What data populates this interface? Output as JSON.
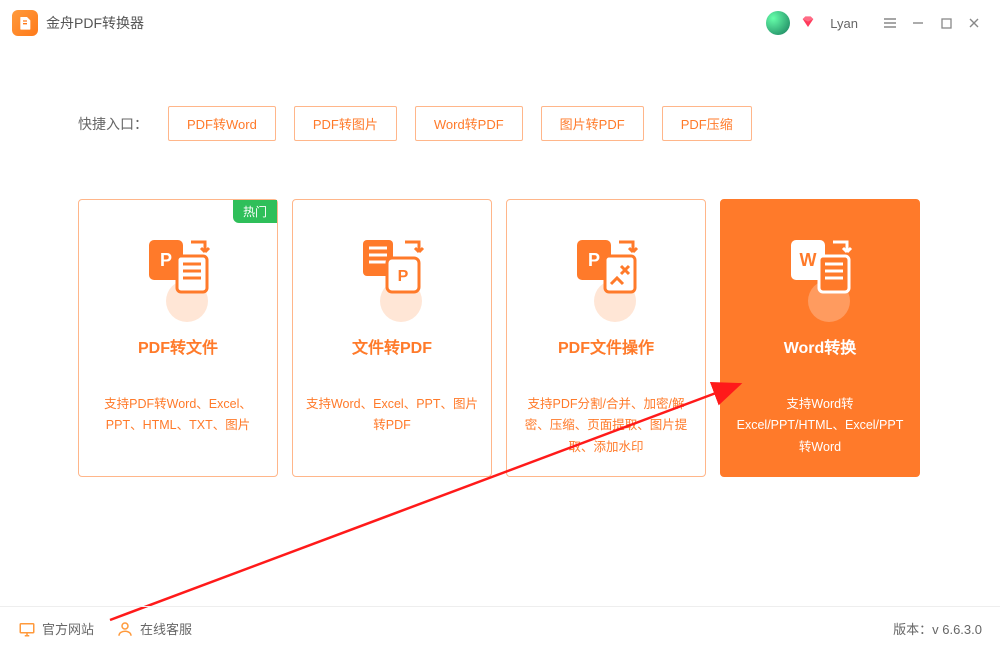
{
  "app": {
    "title": "金舟PDF转换器",
    "username": "Lyan"
  },
  "quick": {
    "label": "快捷入口：",
    "items": [
      "PDF转Word",
      "PDF转图片",
      "Word转PDF",
      "图片转PDF",
      "PDF压缩"
    ]
  },
  "cards": [
    {
      "title": "PDF转文件",
      "desc": "支持PDF转Word、Excel、PPT、HTML、TXT、图片",
      "badge": "热门"
    },
    {
      "title": "文件转PDF",
      "desc": "支持Word、Excel、PPT、图片转PDF"
    },
    {
      "title": "PDF文件操作",
      "desc": "支持PDF分割/合并、加密/解密、压缩、页面提取、图片提取、添加水印"
    },
    {
      "title": "Word转换",
      "desc": "支持Word转Excel/PPT/HTML、Excel/PPT转Word"
    }
  ],
  "footer": {
    "site": "官方网站",
    "support": "在线客服",
    "version_label": "版本：",
    "version": "v 6.6.3.0"
  }
}
